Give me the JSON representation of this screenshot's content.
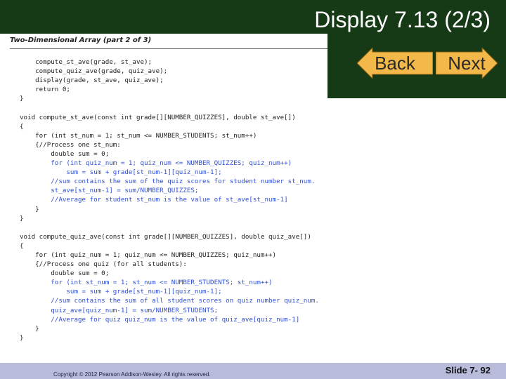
{
  "slide": {
    "title": "Display 7.13 (2/3)",
    "nav": {
      "back_label": "Back",
      "next_label": "Next"
    },
    "footer": {
      "copyright": "Copyright © 2012 Pearson Addison-Wesley.  All rights reserved.",
      "slide_number": "Slide 7- 92"
    },
    "colors": {
      "header": "#163a16",
      "footer": "#b8bcda",
      "button": "#f2b84a",
      "code_highlight": "#2f4fd6"
    }
  },
  "display": {
    "heading": "Two-Dimensional Array (part 2 of 3)",
    "code_lines": [
      {
        "text": "    compute_st_ave(grade, st_ave);",
        "hl": false
      },
      {
        "text": "    compute_quiz_ave(grade, quiz_ave);",
        "hl": false
      },
      {
        "text": "    display(grade, st_ave, quiz_ave);",
        "hl": false
      },
      {
        "text": "    return 0;",
        "hl": false
      },
      {
        "text": "}",
        "hl": false
      },
      {
        "text": "",
        "hl": false
      },
      {
        "text": "void compute_st_ave(const int grade[][NUMBER_QUIZZES], double st_ave[])",
        "hl": false
      },
      {
        "text": "{",
        "hl": false
      },
      {
        "text": "    for (int st_num = 1; st_num <= NUMBER_STUDENTS; st_num++)",
        "hl": false
      },
      {
        "text": "    {//Process one st_num:",
        "hl": false
      },
      {
        "text": "        double sum = 0;",
        "hl": false
      },
      {
        "text": "        for (int quiz_num = 1; quiz_num <= NUMBER_QUIZZES; quiz_num++)",
        "hl": true
      },
      {
        "text": "            sum = sum + grade[st_num-1][quiz_num-1];",
        "hl": true
      },
      {
        "text": "        //sum contains the sum of the quiz scores for student number st_num.",
        "hl": true
      },
      {
        "text": "        st_ave[st_num-1] = sum/NUMBER_QUIZZES;",
        "hl": true
      },
      {
        "text": "        //Average for student st_num is the value of st_ave[st_num-1]",
        "hl": true
      },
      {
        "text": "    }",
        "hl": false
      },
      {
        "text": "}",
        "hl": false
      },
      {
        "text": "",
        "hl": false
      },
      {
        "text": "void compute_quiz_ave(const int grade[][NUMBER_QUIZZES], double quiz_ave[])",
        "hl": false
      },
      {
        "text": "{",
        "hl": false
      },
      {
        "text": "    for (int quiz_num = 1; quiz_num <= NUMBER_QUIZZES; quiz_num++)",
        "hl": false
      },
      {
        "text": "    {//Process one quiz (for all students):",
        "hl": false
      },
      {
        "text": "        double sum = 0;",
        "hl": false
      },
      {
        "text": "        for (int st_num = 1; st_num <= NUMBER_STUDENTS; st_num++)",
        "hl": true
      },
      {
        "text": "            sum = sum + grade[st_num-1][quiz_num-1];",
        "hl": true
      },
      {
        "text": "        //sum contains the sum of all student scores on quiz number quiz_num.",
        "hl": true
      },
      {
        "text": "        quiz_ave[quiz_num-1] = sum/NUMBER_STUDENTS;",
        "hl": true
      },
      {
        "text": "        //Average for quiz quiz_num is the value of quiz_ave[quiz_num-1]",
        "hl": true
      },
      {
        "text": "    }",
        "hl": false
      },
      {
        "text": "}",
        "hl": false
      }
    ]
  }
}
